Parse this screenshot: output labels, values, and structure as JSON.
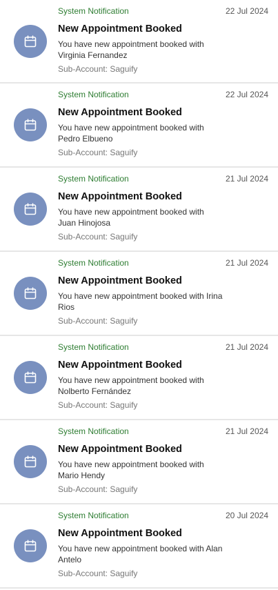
{
  "notifications": [
    {
      "source": "System Notification",
      "date": "22 Jul 2024",
      "title": "New Appointment Booked",
      "message": "You have new appointment booked with Virginia Fernandez",
      "subaccount": "Sub-Account: Saguify",
      "icon": "calendar-icon"
    },
    {
      "source": "System Notification",
      "date": "22 Jul 2024",
      "title": "New Appointment Booked",
      "message": "You have new appointment booked with Pedro Elbueno",
      "subaccount": "Sub-Account: Saguify",
      "icon": "calendar-icon"
    },
    {
      "source": "System Notification",
      "date": "21 Jul 2024",
      "title": "New Appointment Booked",
      "message": "You have new appointment booked with Juan Hinojosa",
      "subaccount": "Sub-Account: Saguify",
      "icon": "calendar-icon"
    },
    {
      "source": "System Notification",
      "date": "21 Jul 2024",
      "title": "New Appointment Booked",
      "message": "You have new appointment booked with Irina Rios",
      "subaccount": "Sub-Account: Saguify",
      "icon": "calendar-icon"
    },
    {
      "source": "System Notification",
      "date": "21 Jul 2024",
      "title": "New Appointment Booked",
      "message": "You have new appointment booked with Nolberto Fernández",
      "subaccount": "Sub-Account: Saguify",
      "icon": "calendar-icon"
    },
    {
      "source": "System Notification",
      "date": "21 Jul 2024",
      "title": "New Appointment Booked",
      "message": "You have new appointment booked with Mario Hendy",
      "subaccount": "Sub-Account: Saguify",
      "icon": "calendar-icon"
    },
    {
      "source": "System Notification",
      "date": "20 Jul 2024",
      "title": "New Appointment Booked",
      "message": "You have new appointment booked with Alan Antelo",
      "subaccount": "Sub-Account: Saguify",
      "icon": "calendar-icon"
    }
  ],
  "colors": {
    "avatar_bg": "#7990bf",
    "source_text": "#2e7d32",
    "divider": "#e6e6e6"
  }
}
